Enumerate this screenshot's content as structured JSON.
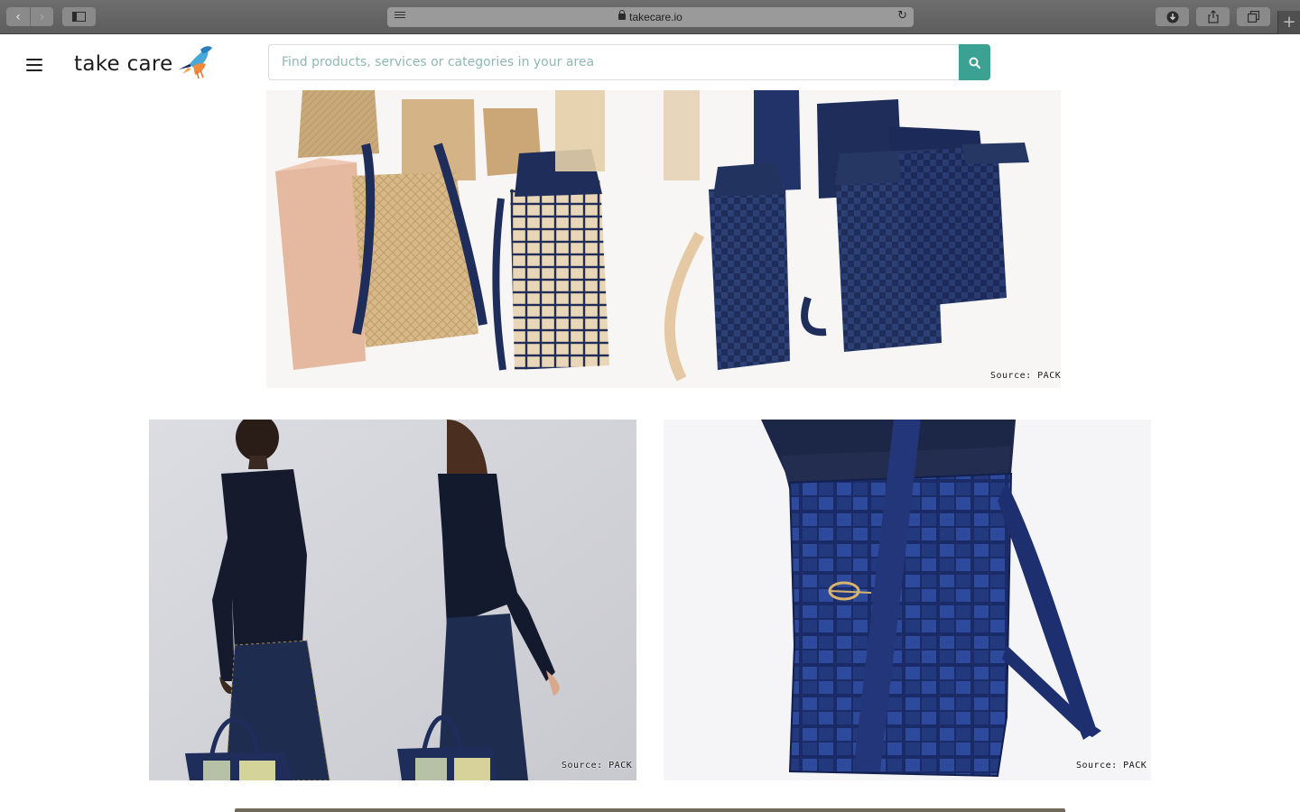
{
  "browser": {
    "url": "takecare.io",
    "icons": [
      "back-arrow-icon",
      "forward-arrow-icon",
      "sidebar-icon",
      "reader-icon",
      "lock-icon",
      "reload-icon",
      "download-icon",
      "share-icon",
      "tabs-icon",
      "new-tab-icon"
    ]
  },
  "header": {
    "logo_text": "take care",
    "search_placeholder": "Find products, services or categories in your area",
    "icons": [
      "menu-icon",
      "kingfisher-logo-icon",
      "search-icon"
    ]
  },
  "gallery": {
    "hero_source": "Source: PACK",
    "left_source": "Source: PACK",
    "right_source": "Source: PACK"
  },
  "colors": {
    "accent": "#3aa193",
    "navy": "#1e2d5a",
    "straw": "#d9b98a"
  }
}
